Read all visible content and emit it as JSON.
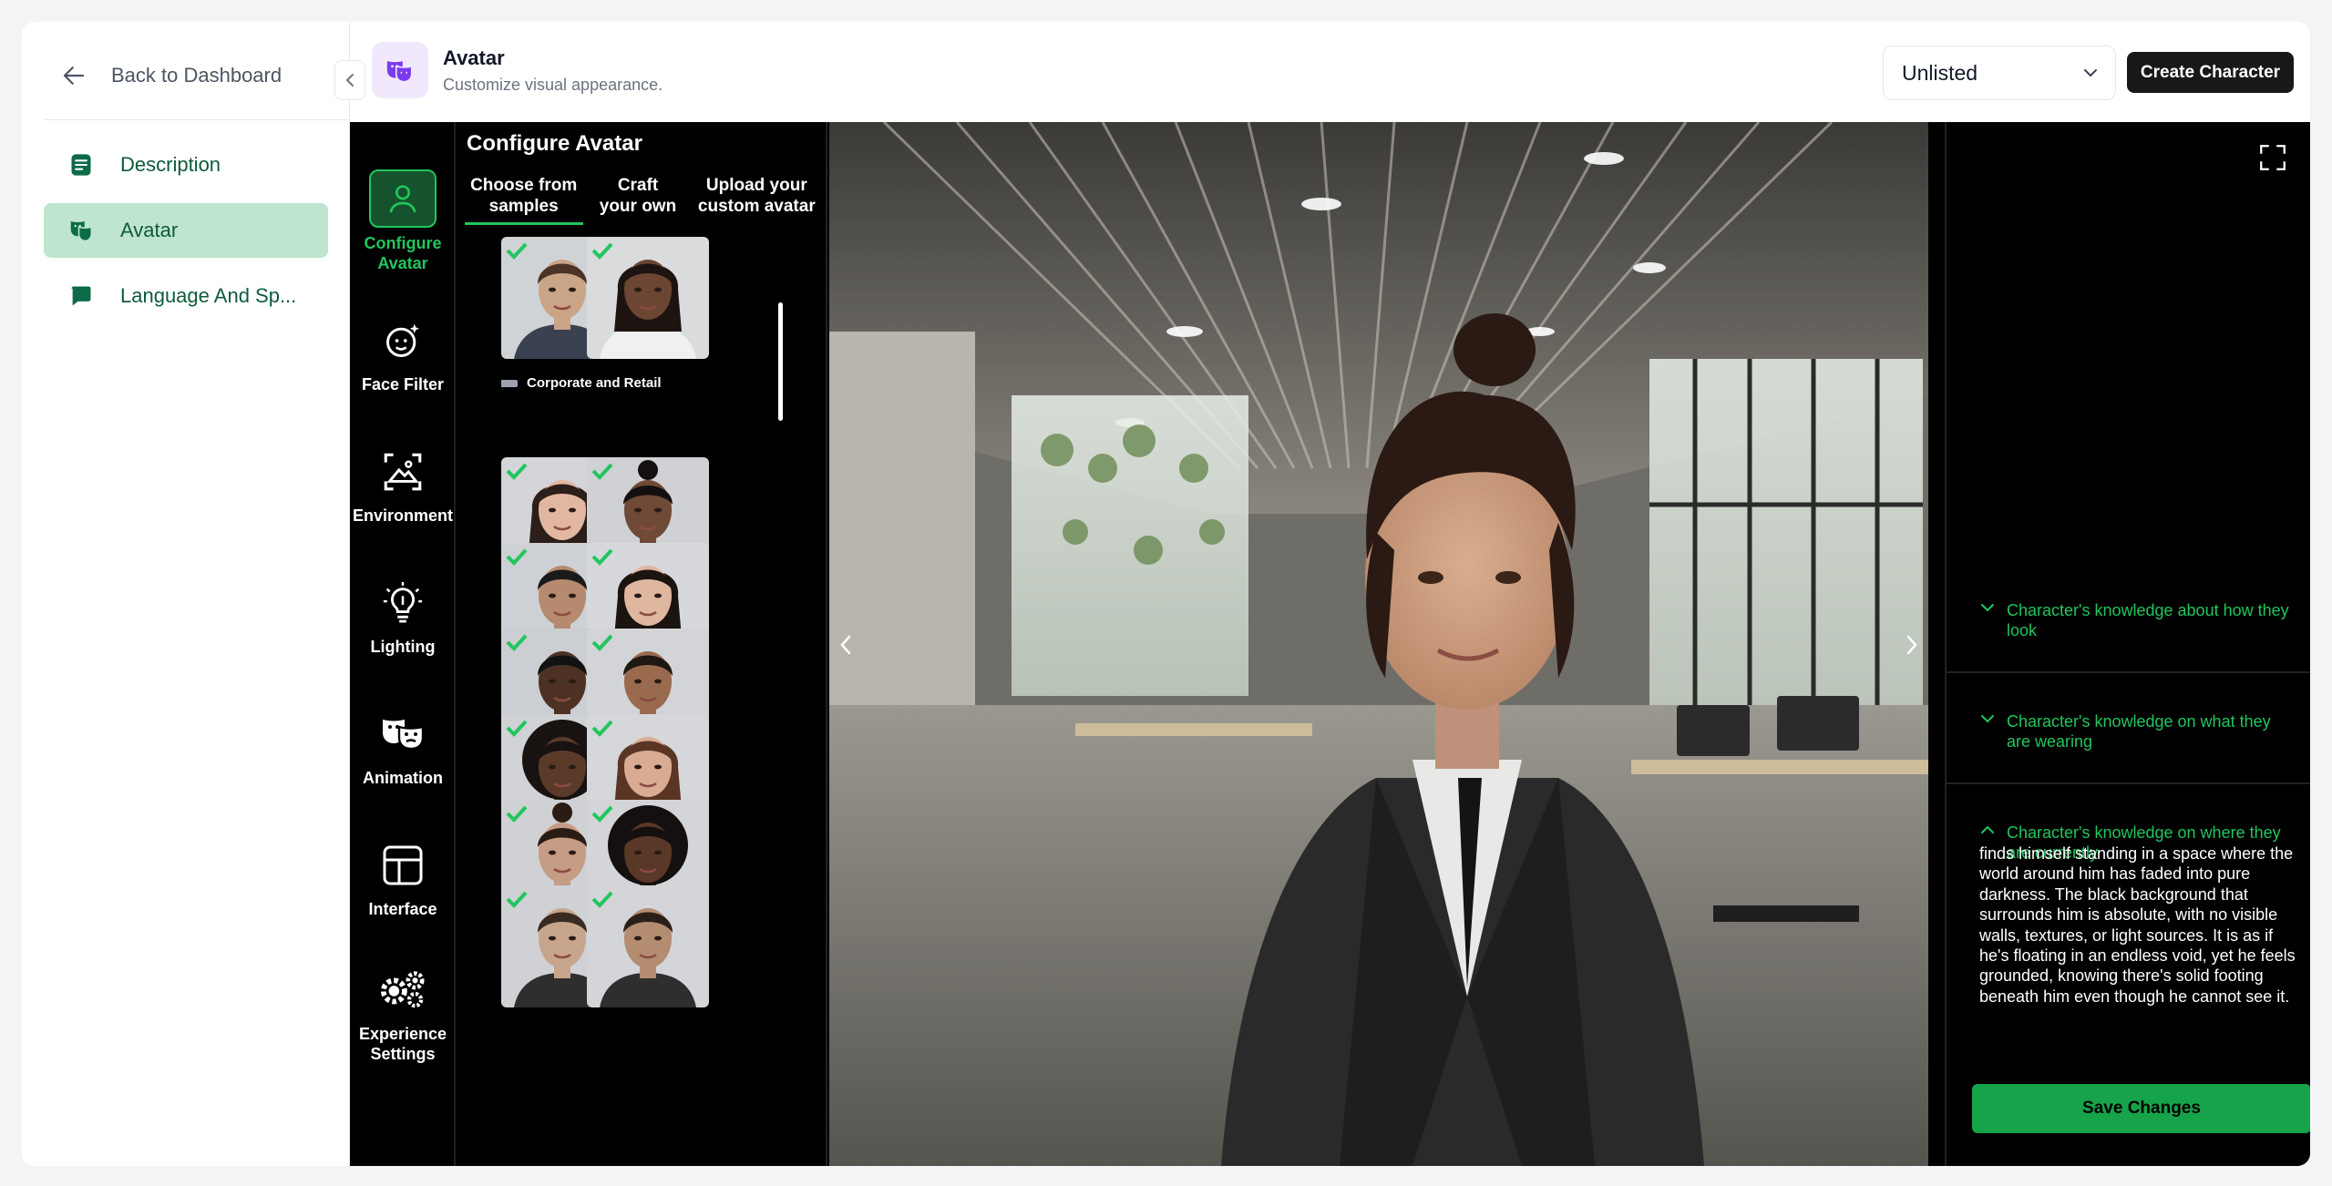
{
  "sidebar": {
    "back_label": "Back to Dashboard",
    "items": [
      {
        "label": "Description",
        "icon": "document-icon"
      },
      {
        "label": "Avatar",
        "icon": "theater-mask-icon",
        "active": true
      },
      {
        "label": "Language And Sp...",
        "icon": "chat-bubble-icon"
      }
    ]
  },
  "header": {
    "title": "Avatar",
    "subtitle": "Customize visual appearance.",
    "visibility_value": "Unlisted",
    "create_label": "Create Character"
  },
  "tools": [
    {
      "label": "Configure Avatar",
      "icon": "person-icon",
      "active": true
    },
    {
      "label": "Face Filter",
      "icon": "face-sparkle-icon"
    },
    {
      "label": "Environment",
      "icon": "landscape-icon"
    },
    {
      "label": "Lighting",
      "icon": "lightbulb-icon"
    },
    {
      "label": "Animation",
      "icon": "theater-mask-icon"
    },
    {
      "label": "Interface",
      "icon": "layout-icon"
    },
    {
      "label": "Experience Settings",
      "icon": "gears-icon"
    }
  ],
  "config": {
    "title": "Configure Avatar",
    "tabs": [
      {
        "label": "Choose from samples",
        "active": true
      },
      {
        "label": "Craft your own"
      },
      {
        "label": "Upload your custom avatar"
      }
    ],
    "group_label": "Corporate and Retail"
  },
  "knowledge": {
    "sections": [
      {
        "title": "Character's knowledge about how they look",
        "expanded": false
      },
      {
        "title": "Character's knowledge on what they are wearing",
        "expanded": false
      },
      {
        "title": "Character's knowledge on where they are currently",
        "expanded": true
      }
    ],
    "location_text": "finds himself standing in a space where the world around him has faded into pure darkness. The black background that surrounds him is absolute, with no visible walls, textures, or light sources. It is as if he's floating in an endless void, yet he feels grounded, knowing there's solid footing beneath him even though he cannot see it.",
    "save_label": "Save Changes"
  },
  "colors": {
    "accent_green": "#22c55e",
    "active_nav_bg": "#bfe5cf",
    "brand_purple": "#7c3aed"
  }
}
